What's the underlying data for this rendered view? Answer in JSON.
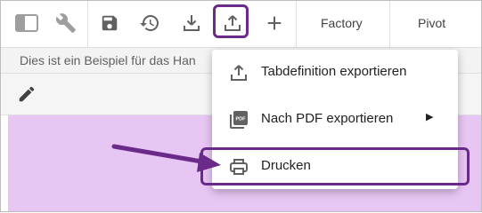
{
  "toolbar": {
    "icons": [
      "sidebar-icon",
      "wrench-icon",
      "save-icon",
      "history-icon",
      "download-icon",
      "export-icon",
      "add-icon"
    ],
    "factory_label": "Factory",
    "pivot_label": "Pivot"
  },
  "description": {
    "text": "Dies ist ein Beispiel für das Han"
  },
  "editbar": {
    "icon": "pencil-icon"
  },
  "export_menu": {
    "items": [
      {
        "label": "Tabdefinition exportieren",
        "icon": "upload-icon"
      },
      {
        "label": "Nach PDF exportieren",
        "icon": "pdf-icon",
        "has_submenu": true,
        "submenu_indicator": "▶"
      },
      {
        "label": "Drucken",
        "icon": "printer-icon"
      }
    ]
  },
  "colors": {
    "highlight": "#6a2a8a",
    "content_background": "#e8c6f3",
    "icon": "#616161"
  }
}
